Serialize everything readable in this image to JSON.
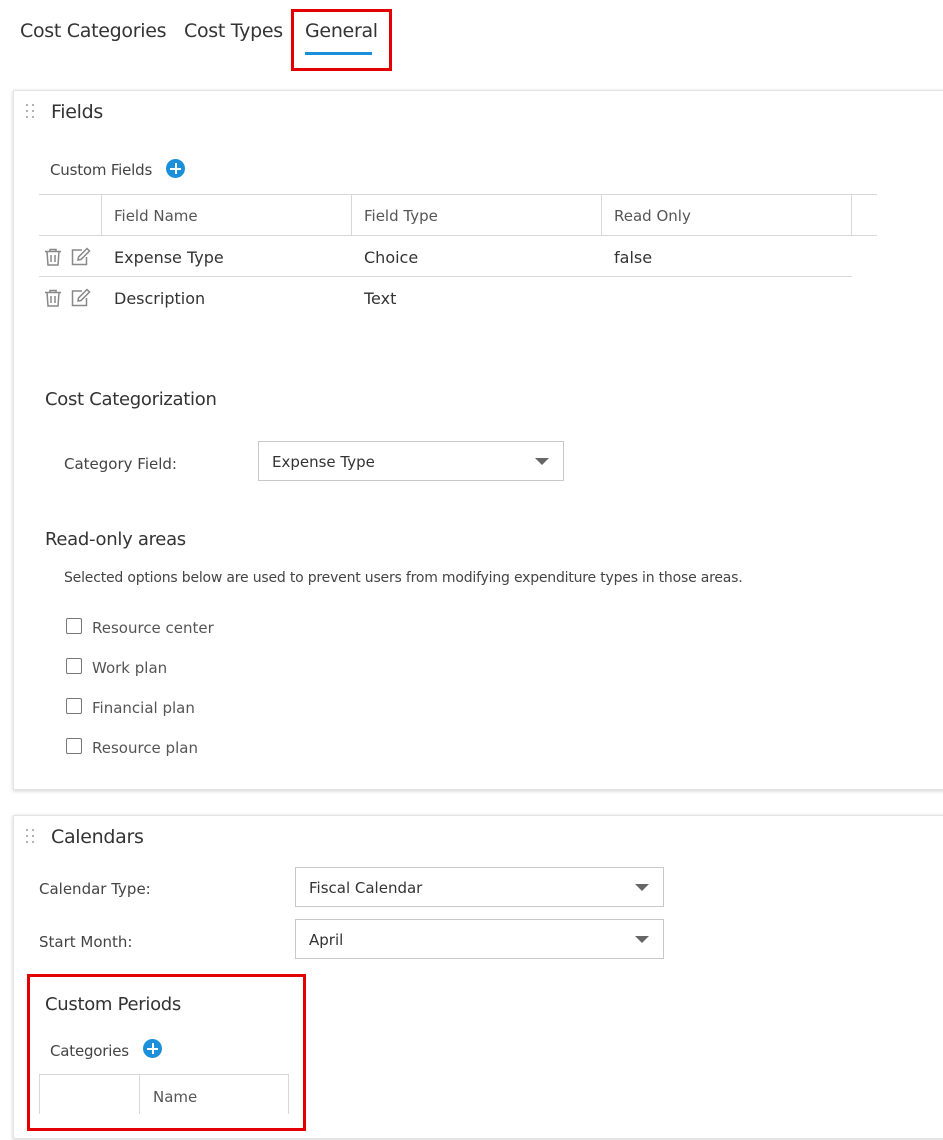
{
  "tabs": [
    {
      "label": "Cost Categories"
    },
    {
      "label": "Cost Types"
    },
    {
      "label": "General"
    }
  ],
  "fields_panel": {
    "title": "Fields",
    "custom_fields_label": "Custom Fields",
    "columns": [
      "Field Name",
      "Field Type",
      "Read Only"
    ],
    "rows": [
      {
        "name": "Expense Type",
        "type": "Choice",
        "read_only": "false"
      },
      {
        "name": "Description",
        "type": "Text",
        "read_only": ""
      }
    ],
    "cost_categorization": {
      "title": "Cost Categorization",
      "category_field_label": "Category Field:",
      "category_field_value": "Expense Type"
    },
    "read_only_areas": {
      "title": "Read-only areas",
      "description": "Selected options below are used to prevent users from modifying expenditure types in those areas.",
      "options": [
        {
          "label": "Resource center",
          "checked": false
        },
        {
          "label": "Work plan",
          "checked": false
        },
        {
          "label": "Financial plan",
          "checked": false
        },
        {
          "label": "Resource plan",
          "checked": false
        }
      ]
    }
  },
  "calendars_panel": {
    "title": "Calendars",
    "calendar_type_label": "Calendar Type:",
    "calendar_type_value": "Fiscal Calendar",
    "start_month_label": "Start Month:",
    "start_month_value": "April",
    "custom_periods": {
      "title": "Custom Periods",
      "categories_label": "Categories",
      "columns": [
        "Name"
      ]
    }
  },
  "colors": {
    "accent": "#1b8fd9",
    "highlight": "#e20000"
  }
}
